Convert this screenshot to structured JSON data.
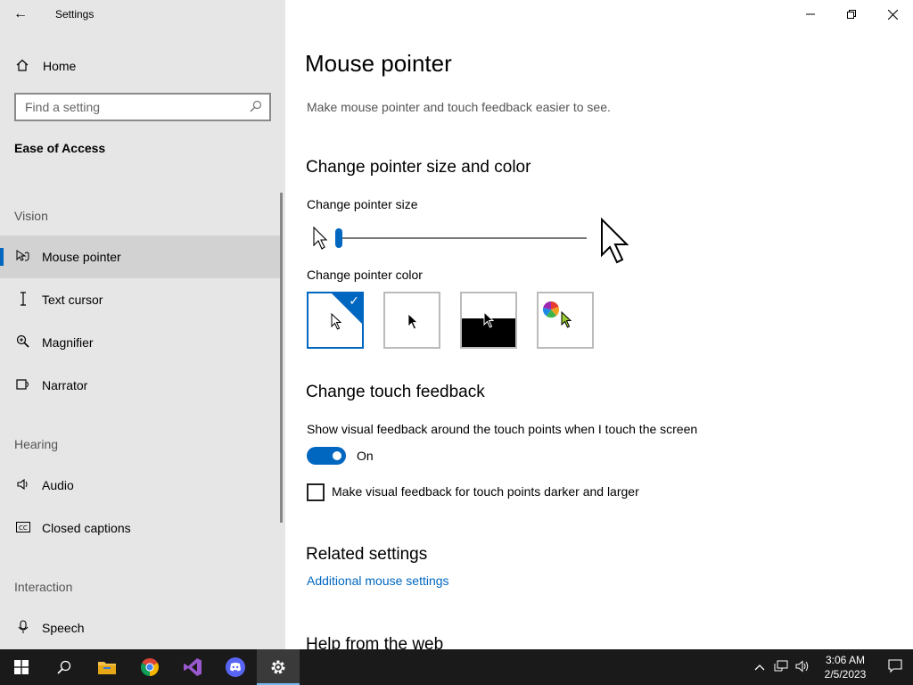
{
  "window": {
    "app_title": "Settings",
    "back_icon": "back-arrow-icon",
    "controls": [
      "minimize",
      "restore",
      "close"
    ]
  },
  "sidebar": {
    "home_label": "Home",
    "search_placeholder": "Find a setting",
    "category": "Ease of Access",
    "sections": [
      {
        "label": "Vision",
        "items": [
          {
            "label": "Mouse pointer",
            "icon": "mouse-pointer-icon",
            "selected": true
          },
          {
            "label": "Text cursor",
            "icon": "text-cursor-icon"
          },
          {
            "label": "Magnifier",
            "icon": "magnifier-icon"
          },
          {
            "label": "Narrator",
            "icon": "narrator-icon"
          }
        ]
      },
      {
        "label": "Hearing",
        "items": [
          {
            "label": "Audio",
            "icon": "audio-icon"
          },
          {
            "label": "Closed captions",
            "icon": "closed-captions-icon"
          }
        ]
      },
      {
        "label": "Interaction",
        "items": [
          {
            "label": "Speech",
            "icon": "speech-icon"
          }
        ]
      }
    ]
  },
  "main": {
    "title": "Mouse pointer",
    "subtitle": "Make mouse pointer and touch feedback easier to see.",
    "size_color_heading": "Change pointer size and color",
    "pointer_size_label": "Change pointer size",
    "pointer_size_value": 1,
    "pointer_color_label": "Change pointer color",
    "pointer_color_options": [
      "white",
      "black",
      "inverted",
      "custom"
    ],
    "pointer_color_selected": "white",
    "touch_heading": "Change touch feedback",
    "touch_feedback_label": "Show visual feedback around the touch points when I touch the screen",
    "touch_toggle_state": "On",
    "darker_label": "Make visual feedback for touch points darker and larger",
    "darker_checked": false,
    "related_heading": "Related settings",
    "related_link": "Additional mouse settings",
    "help_heading": "Help from the web"
  },
  "taskbar": {
    "apps": [
      "windows-start",
      "search",
      "file-explorer",
      "chrome",
      "visual-studio",
      "discord",
      "settings"
    ],
    "active_app": "settings",
    "time": "3:06 AM",
    "date": "2/5/2023"
  },
  "colors": {
    "accent": "#0067c0",
    "sidebar_bg": "#e6e6e6",
    "taskbar_bg": "#1a1a1a"
  }
}
